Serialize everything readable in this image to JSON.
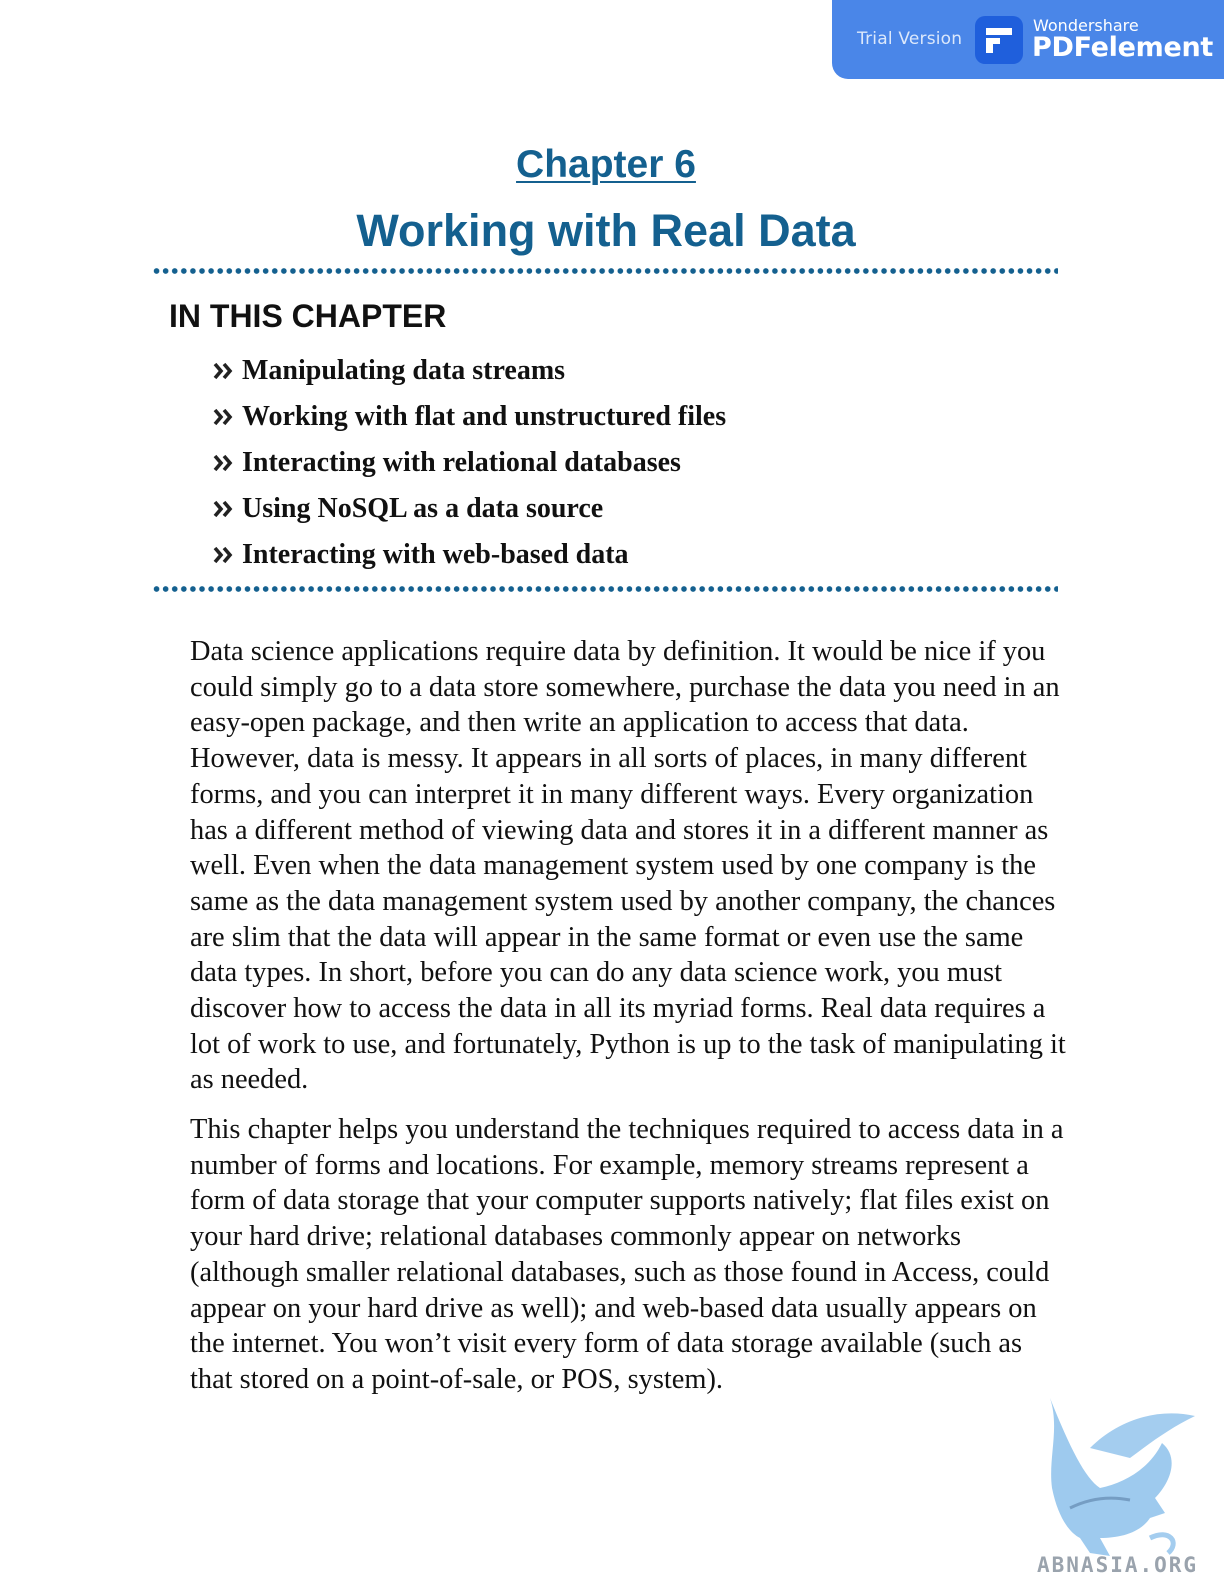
{
  "banner": {
    "trial_label": "Trial Version",
    "brand_small": "Wondershare",
    "brand_big": "PDFelement",
    "color": "#4a86e8"
  },
  "chapter": {
    "label": "Chapter 6",
    "title": "Working with Real Data",
    "accent_color": "#14608f"
  },
  "in_this_chapter": {
    "heading": "IN THIS CHAPTER",
    "items": [
      "Manipulating data streams",
      "Working with flat and unstructured files",
      "Interacting with relational databases",
      "Using NoSQL as a data source",
      "Interacting with web-based data"
    ]
  },
  "body": {
    "paragraphs": [
      "Data science applications require data by definition. It would be nice if you could simply go to a data store somewhere, purchase the data you need in an easy-open package, and then write an application to access that data. However, data is messy. It appears in all sorts of places, in many different forms, and you can interpret it in many different ways. Every organization has a different method of viewing data and stores it in a different manner as well. Even when the data management system used by one company is the same as the data management system used by another company, the chances are slim that the data will appear in the same format or even use the same data types. In short, before you can do any data science work, you must discover how to access the data in all its myriad forms. Real data requires a lot of work to use, and fortunately, Python is up to the task of manipulating it as needed.",
      "This chapter helps you understand the techniques required to access data in a number of forms and locations. For example, memory streams represent a form of data storage that your computer supports natively; flat files exist on your hard drive; relational databases commonly appear on networks (although smaller relational databases, such as those found in Access, could appear on your hard drive as well); and web-based data usually appears on the internet. You won’t visit every form of data storage available (such as that stored on a point-of-sale, or POS, system)."
    ]
  },
  "watermark": {
    "text": "ABNASIA.ORG"
  }
}
